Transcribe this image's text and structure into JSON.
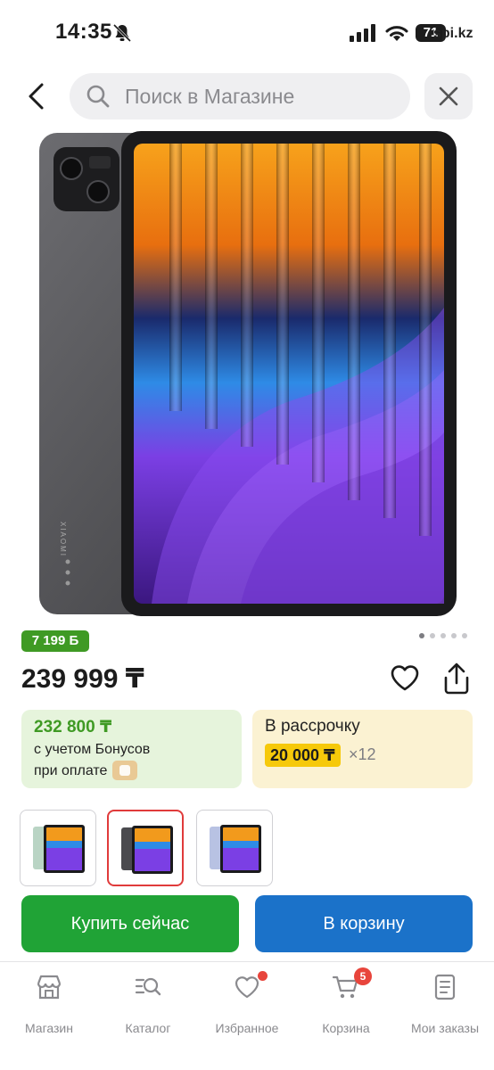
{
  "status_bar": {
    "time": "14:35",
    "battery": "71",
    "watermark": "spi.kz"
  },
  "search": {
    "placeholder": "Поиск в Магазине"
  },
  "product": {
    "bonus_badge": "7 199 Б",
    "price": "239 999 ₸",
    "bonus_card": {
      "price": "232 800 ₸",
      "line1": "с учетом Бонусов",
      "line2": "при оплате"
    },
    "installment": {
      "title": "В рассрочку",
      "amount": "20 000 ₸",
      "months": "×12"
    },
    "variants": [
      {
        "color": "green",
        "selected": false
      },
      {
        "color": "gray",
        "selected": true
      },
      {
        "color": "blue",
        "selected": false
      }
    ],
    "image_pager": {
      "count": 5,
      "active": 0
    }
  },
  "actions": {
    "buy_now": "Купить сейчас",
    "add_to_cart": "В корзину"
  },
  "tab_bar": {
    "items": [
      {
        "label": "Магазин",
        "icon": "store-icon"
      },
      {
        "label": "Каталог",
        "icon": "catalog-icon"
      },
      {
        "label": "Избранное",
        "icon": "heart-icon"
      },
      {
        "label": "Корзина",
        "icon": "cart-icon",
        "badge": "5"
      },
      {
        "label": "Мои заказы",
        "icon": "orders-icon"
      }
    ]
  },
  "colors": {
    "green": "#20a336",
    "blue": "#1b72c9",
    "badge_red": "#e8453c",
    "installment_yellow": "#f6c90a"
  }
}
